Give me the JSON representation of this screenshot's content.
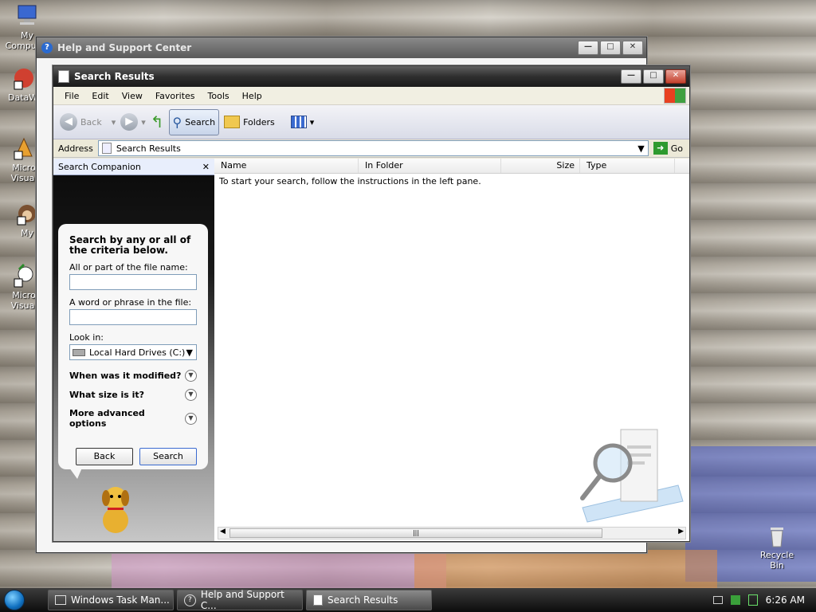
{
  "desktop": {
    "icons": [
      {
        "label": "My Computer",
        "icon": "computer-icon"
      },
      {
        "label": "DataWi",
        "icon": "datawindow-icon"
      },
      {
        "label": "Micro Visual",
        "icon": "visual-studio-icon"
      },
      {
        "label": "My",
        "icon": "monkey-icon"
      },
      {
        "label": "Micro Visual",
        "icon": "visual-studio-icon"
      }
    ],
    "recycle_bin": {
      "label": "Recycle Bin",
      "icon": "recycle-bin-icon"
    }
  },
  "help_window": {
    "title": "Help and Support Center"
  },
  "search_window": {
    "title": "Search Results",
    "menu": [
      "File",
      "Edit",
      "View",
      "Favorites",
      "Tools",
      "Help"
    ],
    "toolbar": {
      "back_label": "Back",
      "search_label": "Search",
      "folders_label": "Folders"
    },
    "address": {
      "label": "Address",
      "value": "Search Results",
      "go_label": "Go"
    },
    "companion": {
      "title": "Search Companion",
      "heading": "Search by any or all of the criteria below.",
      "file_name_label": "All or part of the file name:",
      "file_name_value": "",
      "phrase_label": "A word or phrase in the file:",
      "phrase_value": "",
      "look_in_label": "Look in:",
      "look_in_value": "Local Hard Drives (C:)",
      "options": [
        "When was it modified?",
        "What size is it?",
        "More advanced options"
      ],
      "back_button": "Back",
      "search_button": "Search"
    },
    "results": {
      "columns": [
        "Name",
        "In Folder",
        "Size",
        "Type"
      ],
      "empty_message": "To start your search, follow the instructions in the left pane."
    }
  },
  "taskbar": {
    "tasks": [
      {
        "label": "Windows Task Man...",
        "icon": "task-manager-icon"
      },
      {
        "label": "Help and Support C...",
        "icon": "help-icon"
      },
      {
        "label": "Search Results",
        "icon": "search-results-icon"
      }
    ],
    "clock": "6:26 AM"
  }
}
